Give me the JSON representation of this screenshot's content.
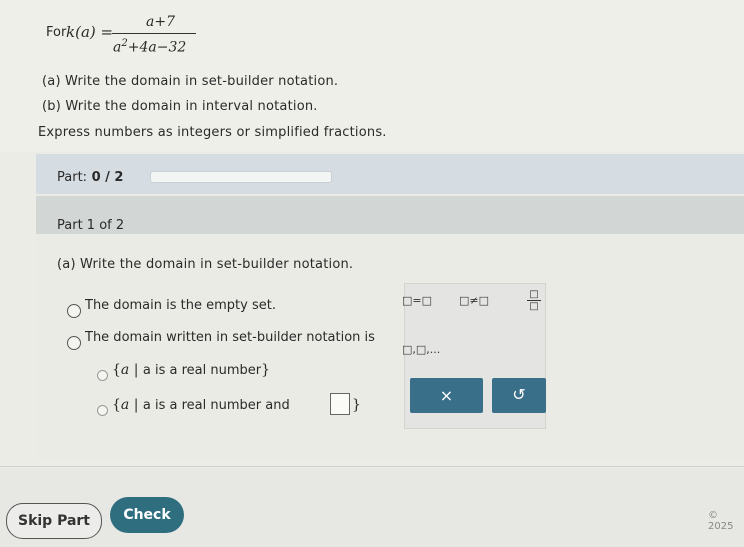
{
  "problem": {
    "for_label": "For",
    "fn_name": "k",
    "fn_arg": "a",
    "numerator": "a+7",
    "denominator_base": "a",
    "denominator_exp": "2",
    "denominator_rest": "+4a−32",
    "part_a": "(a) Write the domain in set-builder notation.",
    "part_b": "(b) Write the domain in interval notation.",
    "instruction": "Express numbers as integers or simplified fractions."
  },
  "progress": {
    "label": "Part:",
    "value": "0 / 2",
    "fraction": 0
  },
  "part": {
    "header": "Part 1 of 2",
    "question": "(a) Write the domain in set-builder notation.",
    "options": [
      "The domain is the empty set.",
      "The domain written in set-builder notation is"
    ],
    "sub_options": [
      {
        "open": "{",
        "var": "a",
        "bar": "|",
        "text": "a is a real number",
        "close": "}"
      },
      {
        "open": "{",
        "var": "a",
        "bar": "|",
        "text": "a is a real number and",
        "close": "}"
      }
    ]
  },
  "toolbox": {
    "equals": "□=□",
    "not_equals": "□≠□",
    "fraction_top": "□",
    "fraction_bottom": "□",
    "list": "□,□,...",
    "clear": "×",
    "undo": "↺"
  },
  "footer": {
    "skip": "Skip Part",
    "check": "Check",
    "copyright": "© 2025"
  },
  "colors": {
    "accent": "#3a6f8a",
    "check": "#2e6e7f"
  }
}
